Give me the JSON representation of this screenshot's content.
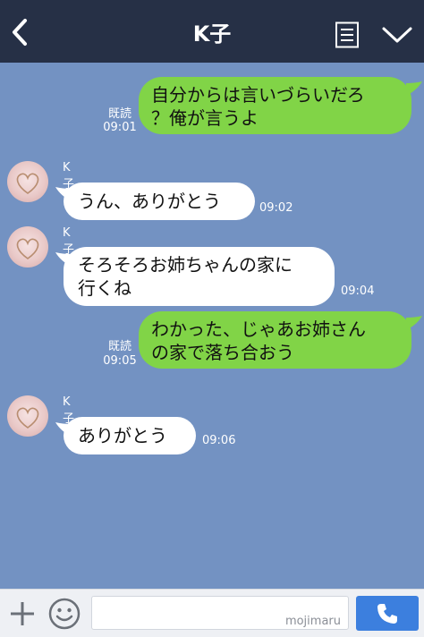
{
  "header": {
    "title": "K子",
    "back_icon": "back-chevron-icon",
    "menu_icon": "notes-icon",
    "dropdown_icon": "chevron-down-icon",
    "background": "#263046"
  },
  "chat": {
    "background": "#7392c2",
    "messages": [
      {
        "direction": "out",
        "text": "自分からは言いづらいだろ\n？俺が言うよ",
        "read": "既読",
        "time": "09:01"
      },
      {
        "direction": "in",
        "sender": "K子",
        "text": "うん、ありがとう",
        "time": "09:02"
      },
      {
        "direction": "in",
        "sender": "K子",
        "text": "そろそろお姉ちゃんの家に\n行くね",
        "time": "09:04"
      },
      {
        "direction": "out",
        "text": "わかった、じゃあお姉さん\nの家で落ち合おう",
        "read": "既読",
        "time": "09:05"
      },
      {
        "direction": "in",
        "sender": "K子",
        "text": "ありがとう",
        "time": "09:06"
      }
    ],
    "outgoing_bubble_color": "#81d447",
    "incoming_bubble_color": "#ffffff"
  },
  "input_bar": {
    "plus_icon": "plus-icon",
    "emoji_icon": "smile-icon",
    "watermark": "mojimaru",
    "call_icon": "phone-icon",
    "call_button_color": "#3c7fde"
  }
}
